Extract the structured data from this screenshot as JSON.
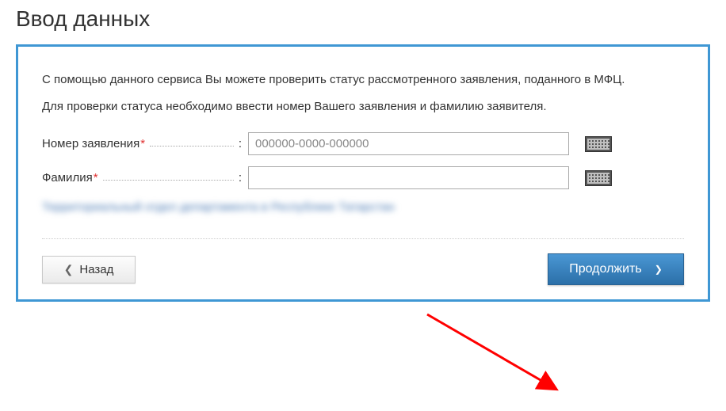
{
  "title": "Ввод данных",
  "intro": "С помощью данного сервиса Вы можете проверить статус рассмотренного заявления, поданного в МФЦ.",
  "sub": "Для проверки статуса необходимо ввести номер Вашего заявления и фамилию заявителя.",
  "fields": {
    "application_number": {
      "label": "Номер заявления",
      "placeholder": "000000-0000-000000",
      "value": ""
    },
    "surname": {
      "label": "Фамилия",
      "placeholder": "",
      "value": ""
    }
  },
  "blurred_text": "Территориальный отдел департамента в Республике Татарстан",
  "buttons": {
    "back": "Назад",
    "continue": "Продолжить"
  }
}
